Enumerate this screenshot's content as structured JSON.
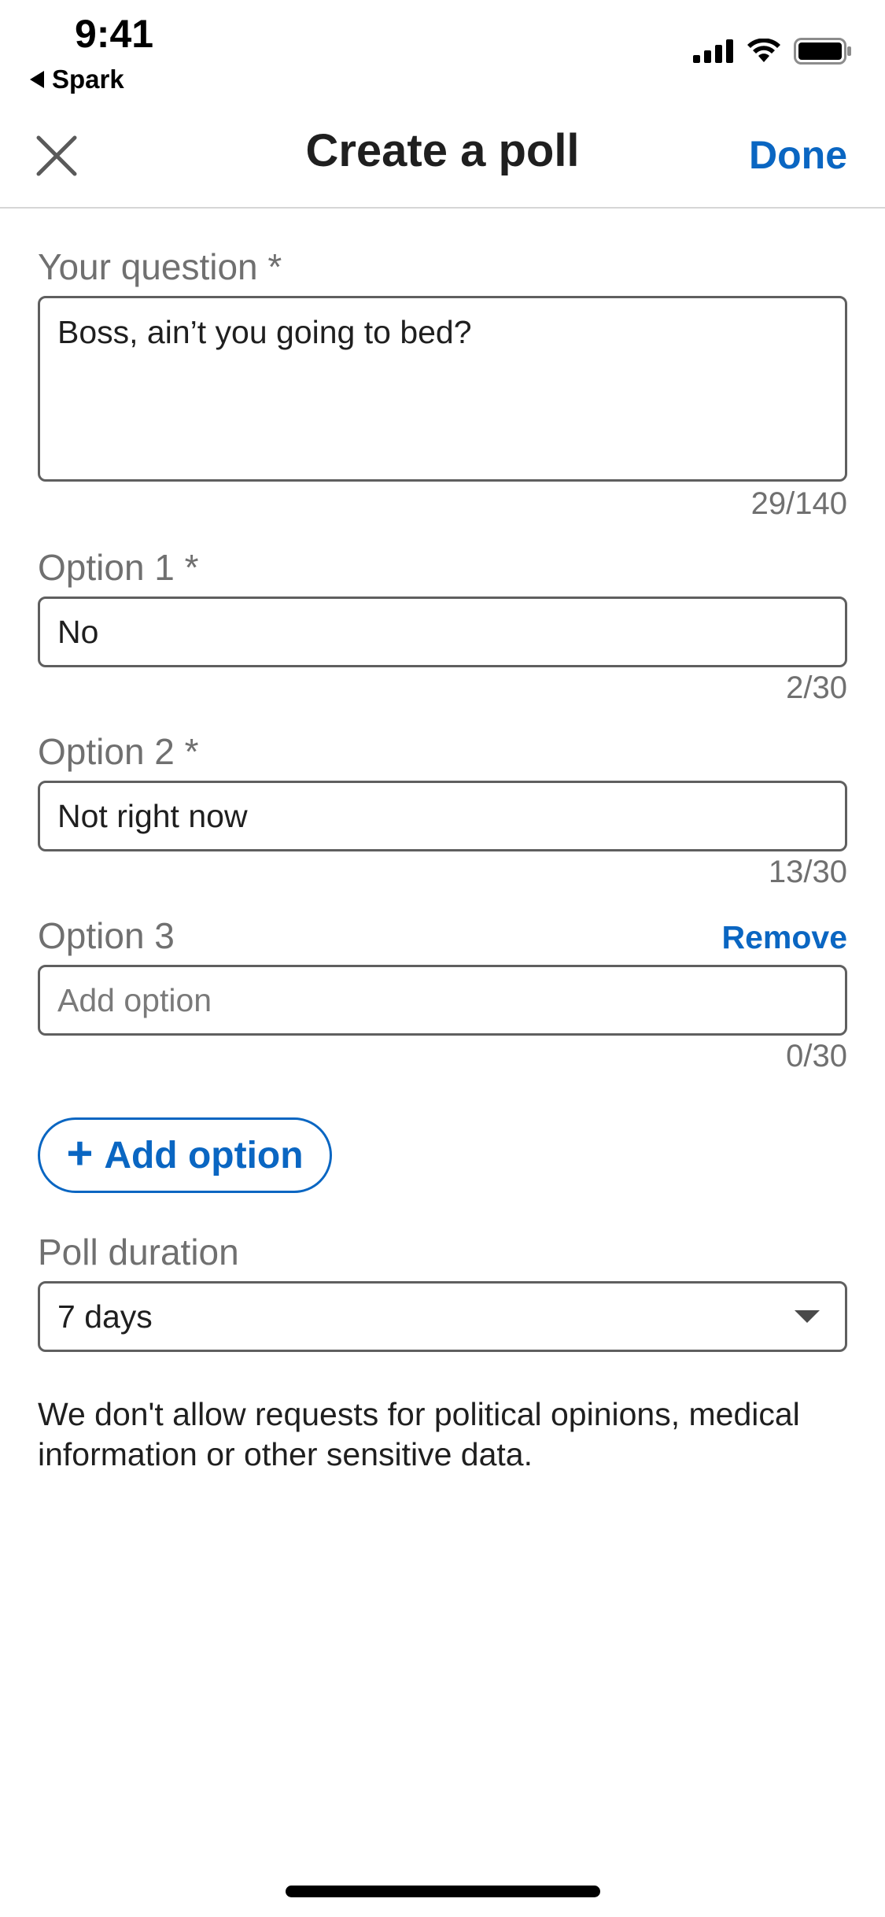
{
  "status_bar": {
    "time": "9:41",
    "back_app": "Spark",
    "icons": [
      "signal-icon",
      "wifi-icon",
      "battery-icon"
    ]
  },
  "header": {
    "title": "Create a poll",
    "done_label": "Done",
    "close_icon": "close-icon"
  },
  "question": {
    "label": "Your question *",
    "value": "Boss, ain’t you going to bed?",
    "counter": "29/140"
  },
  "options": [
    {
      "label": "Option 1 *",
      "value": "No",
      "counter": "2/30"
    },
    {
      "label": "Option 2 *",
      "value": "Not right now",
      "counter": "13/30"
    },
    {
      "label": "Option 3",
      "value": "",
      "placeholder": "Add option",
      "counter": "0/30",
      "remove_label": "Remove"
    }
  ],
  "add_option": {
    "icon": "+",
    "label": "Add option"
  },
  "duration": {
    "label": "Poll duration",
    "selected": "7 days"
  },
  "disclaimer": "We don't allow requests for political opinions, medical information or other sensitive data.",
  "colors": {
    "accent": "#0a66c2",
    "text": "#1f1f1f",
    "muted": "#707070",
    "border": "#5f5f5f"
  }
}
